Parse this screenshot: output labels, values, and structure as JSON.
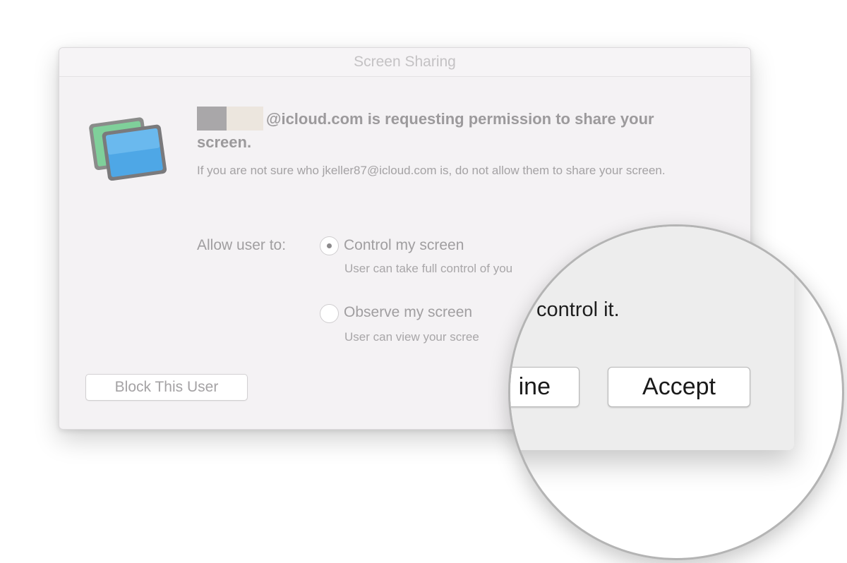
{
  "window": {
    "title": "Screen Sharing"
  },
  "message": {
    "heading": "@icloud.com is requesting permission to share your screen.",
    "subtext": "If you are not sure who jkeller87@icloud.com is, do not allow them to share your screen."
  },
  "allow": {
    "label": "Allow user to:",
    "options": [
      {
        "label": "Control my screen",
        "description": "User can take full control of you",
        "selected": true
      },
      {
        "label": "Observe my screen",
        "description": "User can view your scree",
        "selected": false
      }
    ]
  },
  "buttons": {
    "block": "Block This User",
    "decline_partial": "ine",
    "accept": "Accept"
  },
  "magnifier": {
    "text": "control it."
  },
  "icon": {
    "app": "screen-sharing-icon"
  },
  "colors": {
    "dialog_bg": "#f4f2f4",
    "magnified_bg": "#ededed"
  }
}
